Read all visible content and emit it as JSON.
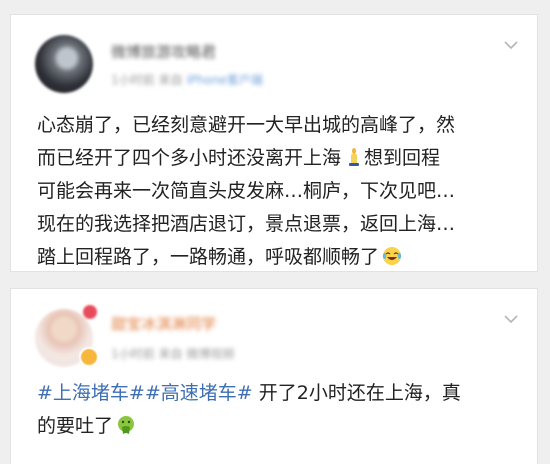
{
  "posts": [
    {
      "username": "微博旅游攻略君",
      "time": "1小时前",
      "source_prefix": "来自",
      "source": "iPhone客户端",
      "text_lines": [
        "心态崩了，已经刻意避开一大早出城的高峰了，然",
        "而已经开了四个多小时还没离开上海",
        "想到回程",
        "可能会再来一次简直头皮发麻…桐庐，下次见吧…",
        "现在的我选择把酒店退订，景点退票，返回上海…",
        "踏上回程路了，一路畅通，呼吸都顺畅了"
      ],
      "emoji_1": "candle-emoji",
      "emoji_2": "laugh-cry-emoji"
    },
    {
      "username": "甜宝冰淇淋同学",
      "time": "1小时前",
      "source_prefix": "来自",
      "source": "微博视频",
      "tag1": "#上海堵车#",
      "tag2": "#高速堵车#",
      "text_rest": "开了2小时还在上海，真",
      "text_line2": "的要吐了",
      "emoji": "vomit-emoji"
    }
  ],
  "icons": {
    "more": "chevron-down-icon"
  }
}
